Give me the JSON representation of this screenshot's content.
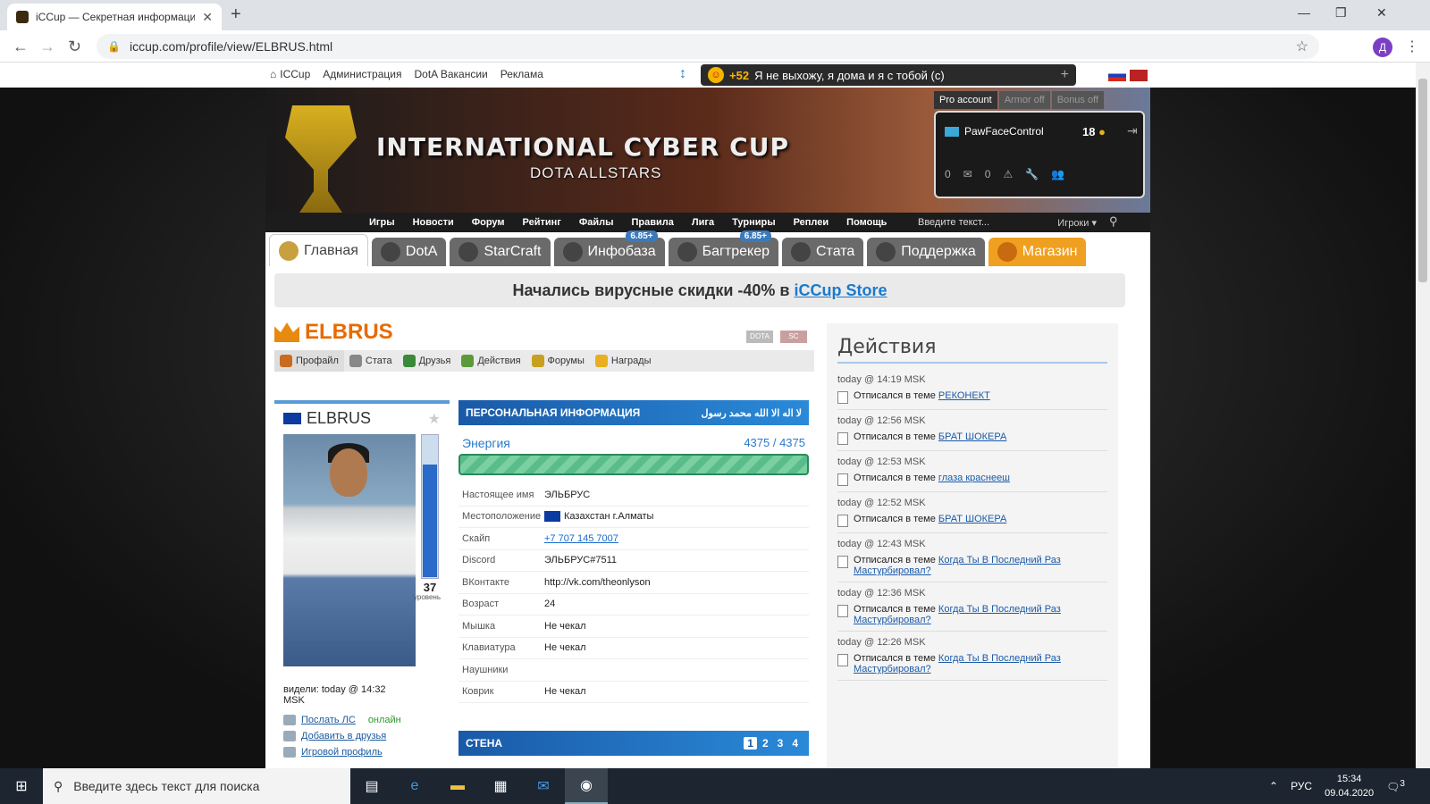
{
  "browser": {
    "tab_title": "iCCup — Секретная информаци",
    "url": "iccup.com/profile/view/ELBRUS.html",
    "profile_initial": "Д"
  },
  "top": {
    "links": [
      "ICCup",
      "Администрация",
      "DotA Вакансии",
      "Реклама"
    ],
    "shout_count": "+52",
    "shout_text": "Я не выхожу, я дома и я с тобой (с)"
  },
  "banner": {
    "title": "INTERNATIONAL CYBER CUP",
    "subtitle": "DOTA ALLSTARS"
  },
  "account": {
    "tabs": [
      "Pro account",
      "Armor off",
      "Bonus off"
    ],
    "username": "PawFaceControl",
    "coins": "18",
    "messages": "0",
    "alerts": "0"
  },
  "menu": {
    "items": [
      "Игры",
      "Новости",
      "Форум",
      "Рейтинг",
      "Файлы",
      "Правила",
      "Лига",
      "Турниры",
      "Реплеи",
      "Помощь"
    ],
    "search_placeholder": "Введите текст...",
    "search_type": "Игроки"
  },
  "nav_tabs": [
    {
      "label": "Главная"
    },
    {
      "label": "DotA"
    },
    {
      "label": "StarCraft"
    },
    {
      "label": "Инфобаза",
      "badge": "6.85+"
    },
    {
      "label": "Багтрекер",
      "badge": "6.85+"
    },
    {
      "label": "Стата"
    },
    {
      "label": "Поддержка"
    },
    {
      "label": "Магазин"
    }
  ],
  "promo": {
    "text": "Начались вирусные скидки -40% в",
    "link": "iCCup Store"
  },
  "profile": {
    "name": "ELBRUS",
    "mini_tags": [
      "DOTA",
      "SC"
    ],
    "subnav": [
      "Профайл",
      "Стата",
      "Друзья",
      "Действия",
      "Форумы",
      "Награды"
    ],
    "level": "37",
    "level_label": "уровень",
    "level_fraction": 0.8,
    "seen": "видели: today @ 14:32 MSK",
    "actions": [
      "Послать ЛС",
      "Добавить в друзья",
      "Игровой профиль"
    ],
    "online": "онлайн"
  },
  "personal": {
    "header": "ПЕРСОНАЛЬНАЯ ИНФОРМАЦИЯ",
    "header_arabic": "لا اله الا الله محمد رسول",
    "energy_label": "Энергия",
    "energy_value": "4375 / 4375",
    "rows": [
      [
        "Настоящее имя",
        "ЭЛЬБРУС"
      ],
      [
        "Местоположение",
        "Казахстан г.Алматы"
      ],
      [
        "Скайп",
        "+7 707 145 7007"
      ],
      [
        "Discord",
        "ЭЛЬБРУС#7511"
      ],
      [
        "ВКонтакте",
        "http://vk.com/theonlyson"
      ],
      [
        "Возраст",
        "24"
      ],
      [
        "Мышка",
        "Не чекал"
      ],
      [
        "Клавиатура",
        "Не чекал"
      ],
      [
        "Наушники",
        ""
      ],
      [
        "Коврик",
        "Не чекал"
      ]
    ]
  },
  "wall": {
    "header": "СТЕНА",
    "pages": [
      "1",
      "2",
      "3",
      "4"
    ]
  },
  "activity": {
    "title": "Действия",
    "prefix": "Отписался в теме",
    "items": [
      {
        "time": "today @ 14:19 MSK",
        "topic": "РЕКОНЕКТ"
      },
      {
        "time": "today @ 12:56 MSK",
        "topic": "БРАТ ШОКЕРА"
      },
      {
        "time": "today @ 12:53 MSK",
        "topic": "глаза краснееш"
      },
      {
        "time": "today @ 12:52 MSK",
        "topic": "БРАТ ШОКЕРА"
      },
      {
        "time": "today @ 12:43 MSK",
        "topic": "Когда Ты В Последний Раз Мастурбировал?"
      },
      {
        "time": "today @ 12:36 MSK",
        "topic": "Когда Ты В Последний Раз Мастурбировал?"
      },
      {
        "time": "today @ 12:26 MSK",
        "topic": "Когда Ты В Последний Раз Мастурбировал?"
      }
    ]
  },
  "taskbar": {
    "search": "Введите здесь текст для поиска",
    "lang": "РУС",
    "time": "15:34",
    "date": "09.04.2020",
    "notif": "3"
  }
}
